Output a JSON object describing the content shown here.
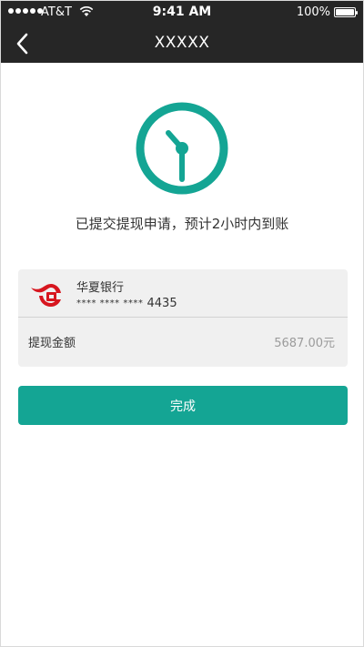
{
  "status_bar": {
    "carrier": "AT&T",
    "time": "9:41 AM",
    "battery": "100%",
    "battery_level": 1.0,
    "signal_dots": 5
  },
  "nav": {
    "title": "XXXXX",
    "back_icon": "chevron-left-icon"
  },
  "result": {
    "icon": "clock-icon",
    "message": "已提交提现申请，预计2小时内到账"
  },
  "bank": {
    "name": "华夏银行",
    "card_mask": "**** **** ****",
    "card_last4": "4435",
    "logo_icon": "hua-xia-bank-logo"
  },
  "withdraw": {
    "label": "提现金额",
    "amount": "5687.00元"
  },
  "done_button": {
    "label": "完成"
  },
  "colors": {
    "accent": "#14a594",
    "topbar": "#262626",
    "card_bg": "#f0f0f0",
    "logo_red": "#d7161f"
  }
}
